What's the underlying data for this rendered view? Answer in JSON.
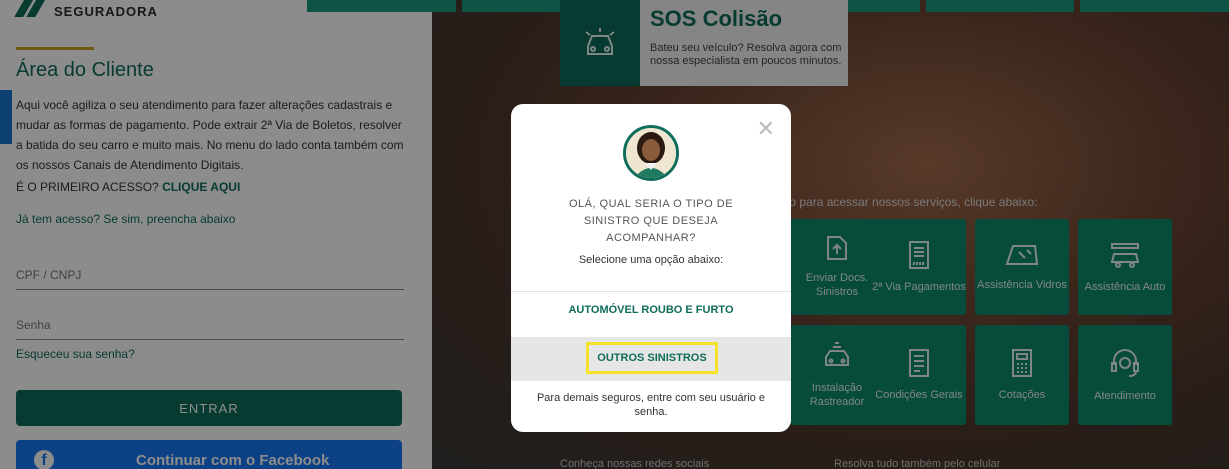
{
  "brand": {
    "logo_text": "SEGURADORA",
    "primary": "#0e6c5b",
    "accent": "#c9a227",
    "facebook": "#1877f2",
    "highlight": "#f2e32a"
  },
  "client_area": {
    "title": "Área do Cliente",
    "description": "Aqui você agiliza o seu atendimento para fazer alterações cadastrais e mudar as formas de pagamento. Pode extrair 2ª Via de Boletos, resolver a batida do seu carro e muito mais. No menu do lado conta também com os nossos Canais de Atendimento Digitais.",
    "first_access_prefix": "É O PRIMEIRO ACESSO?",
    "first_access_link": "CLIQUE AQUI",
    "has_access": "Já tem acesso? Se sim, preencha abaixo",
    "cpf_placeholder": "CPF / CNPJ",
    "password_placeholder": "Senha",
    "forgot_password": "Esqueceu sua senha?",
    "login_button": "ENTRAR",
    "facebook_button": "Continuar com o Facebook"
  },
  "sos": {
    "title": "SOS Colisão",
    "description": "Bateu seu veículo? Resolva agora com nossa especialista em poucos minutos."
  },
  "services": {
    "hint": "ado para acessar nossos serviços, clique abaixo:",
    "tiles": [
      {
        "label": "Enviar Docs. Sinistros",
        "icon": "upload-doc-icon"
      },
      {
        "label": "2ª Via Pagamentos",
        "icon": "barcode-doc-icon"
      },
      {
        "label": "Assistência Vidros",
        "icon": "windshield-icon"
      },
      {
        "label": "Assistência Auto",
        "icon": "tow-truck-icon"
      },
      {
        "label": "Instalação Rastreador",
        "icon": "tracker-car-icon"
      },
      {
        "label": "Condições Gerais",
        "icon": "document-icon"
      },
      {
        "label": "Cotações",
        "icon": "calculator-icon"
      },
      {
        "label": "Atendimento",
        "icon": "headset-icon"
      }
    ],
    "bottom_left": "Conheça nossas redes sociais",
    "bottom_right": "Resolva tudo também pelo celular"
  },
  "modal": {
    "question": "OLÁ, QUAL SERIA O TIPO DE SINISTRO QUE DESEJA ACOMPANHAR?",
    "select_hint": "Selecione uma opção abaixo:",
    "option_auto": "AUTOMÓVEL ROUBO E FURTO",
    "option_outros": "OUTROS SINISTROS",
    "footnote": "Para demais seguros, entre com seu usuário e senha."
  }
}
